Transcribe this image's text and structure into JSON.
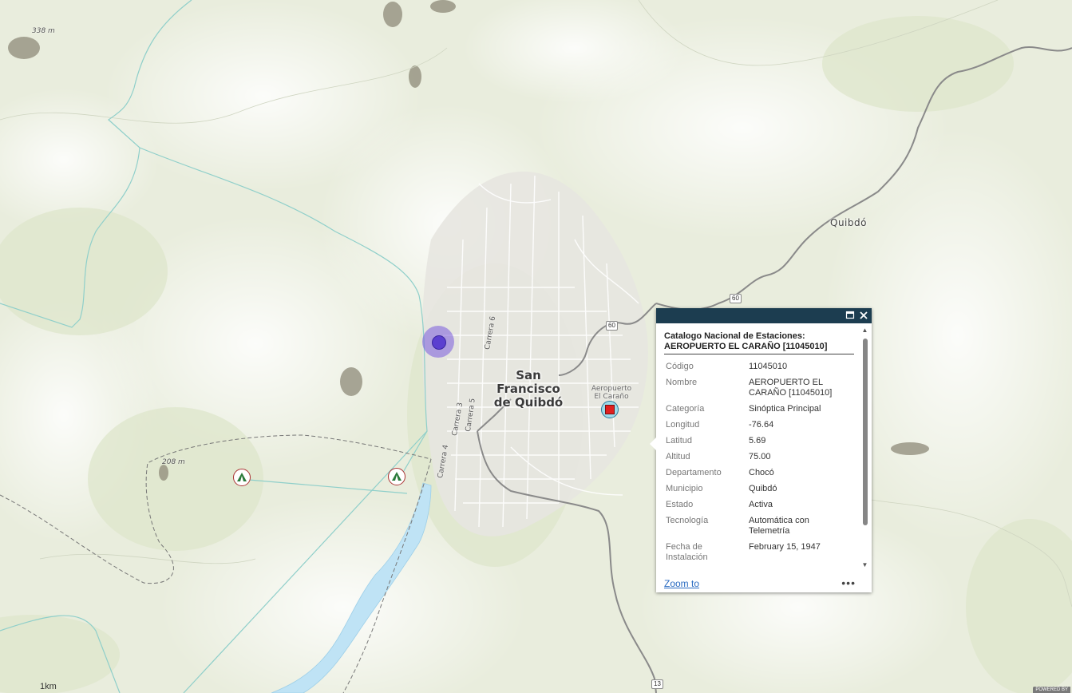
{
  "map": {
    "labels": {
      "city": "San Francisco de Quibdó",
      "city_line1": "San Francisco",
      "city_line2": "de Quibdó",
      "municipality": "Quibdó",
      "airport_line1": "Aeropuerto",
      "airport_line2": "El Caraño",
      "elevation_top": "338 m",
      "elevation_left": "208 m",
      "streets": [
        "Carrera 6",
        "Carrera 4",
        "Carrera 3",
        "Carrera 5"
      ],
      "road_shields": [
        "60",
        "60",
        "13"
      ]
    },
    "scale_label": "1km",
    "attribution": "POWERED BY"
  },
  "popup": {
    "title": "Catalogo Nacional de Estaciones: AEROPUERTO EL CARAÑO [11045010]",
    "title_line1": "Catalogo Nacional de Estaciones:",
    "title_line2": "AEROPUERTO EL CARAÑO [11045010]",
    "fields": [
      {
        "label": "Código",
        "value": "11045010"
      },
      {
        "label": "Nombre",
        "value": "AEROPUERTO EL CARAÑO [11045010]"
      },
      {
        "label": "Categoría",
        "value": "Sinóptica Principal"
      },
      {
        "label": "Longitud",
        "value": "-76.64"
      },
      {
        "label": "Latitud",
        "value": "5.69"
      },
      {
        "label": "Altitud",
        "value": "75.00"
      },
      {
        "label": "Departamento",
        "value": "Chocó"
      },
      {
        "label": "Municipio",
        "value": "Quibdó"
      },
      {
        "label": "Estado",
        "value": "Activa"
      },
      {
        "label": "Tecnología",
        "value": "Automática con Telemetría"
      },
      {
        "label": "Fecha de Instalación",
        "value": "February 15, 1947"
      }
    ],
    "zoom_link": "Zoom to",
    "more_icon": "•••",
    "maximize_icon": "maximize-icon",
    "close_icon": "close-icon"
  },
  "colors": {
    "popup_titlebar": "#1c3d50",
    "station_selected": "#e02020",
    "station_other": "#6a4bd6",
    "river": "#bfe3f5",
    "road": "#8a8a8a"
  }
}
